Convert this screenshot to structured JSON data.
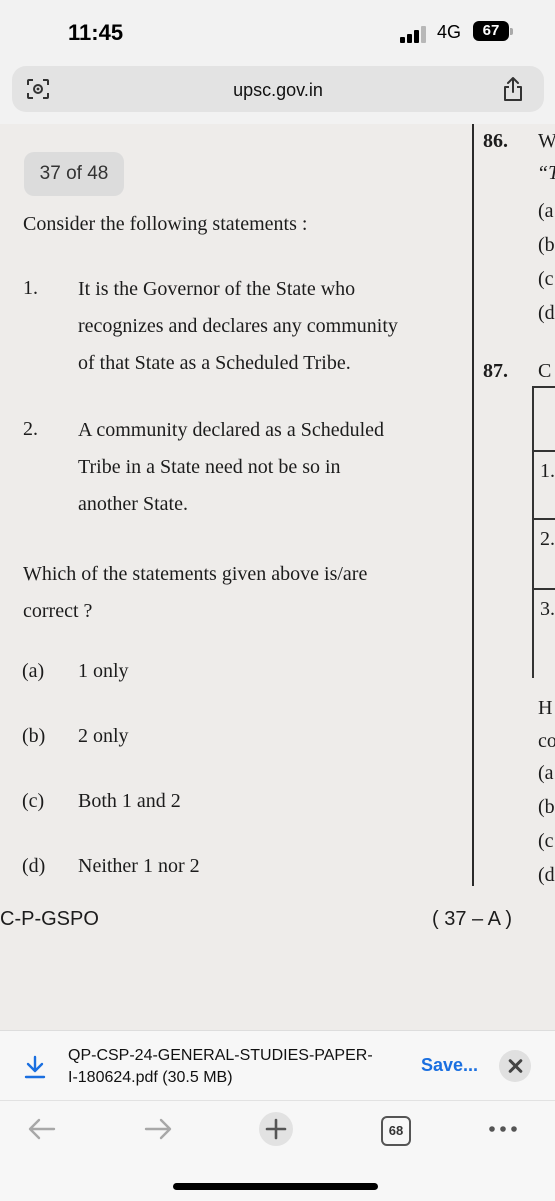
{
  "status_bar": {
    "time": "11:45",
    "network": "4G",
    "battery": "67"
  },
  "browser": {
    "url": "upsc.gov.in"
  },
  "document": {
    "page_indicator": "37 of 48",
    "question_intro": "Consider the following statements :",
    "statements": [
      {
        "num": "1.",
        "lines": [
          "It is the Governor of the State who",
          "recognizes and declares any community",
          "of that State as a Scheduled Tribe."
        ]
      },
      {
        "num": "2.",
        "lines": [
          "A community declared as a Scheduled",
          "Tribe in a State need not be so in",
          "another State."
        ]
      }
    ],
    "question_ask_lines": [
      "Which of the statements given above is/are",
      "correct ?"
    ],
    "options": [
      {
        "label": "(a)",
        "text": "1 only"
      },
      {
        "label": "(b)",
        "text": "2 only"
      },
      {
        "label": "(c)",
        "text": "Both 1 and 2"
      },
      {
        "label": "(d)",
        "text": "Neither 1 nor 2"
      }
    ],
    "footer_left": "C-P-GSPO",
    "footer_right": "( 37 – A )",
    "right_column": {
      "q86": "86.",
      "q86_start": "W",
      "q86_quote": "“T",
      "q86_opts": [
        "(a",
        "(b",
        "(c",
        "(d"
      ],
      "q87": "87.",
      "q87_start": "C",
      "table_rows": [
        "1.",
        "2.",
        "3."
      ],
      "after": [
        "H",
        "co"
      ],
      "q87_opts": [
        "(a",
        "(b",
        "(c",
        "(d"
      ]
    }
  },
  "download": {
    "filename_line1": "QP-CSP-24-GENERAL-STUDIES-PAPER-",
    "filename_line2": "I-180624.pdf (30.5 MB)",
    "save_label": "Save..."
  },
  "toolbar": {
    "tab_count": "68"
  }
}
